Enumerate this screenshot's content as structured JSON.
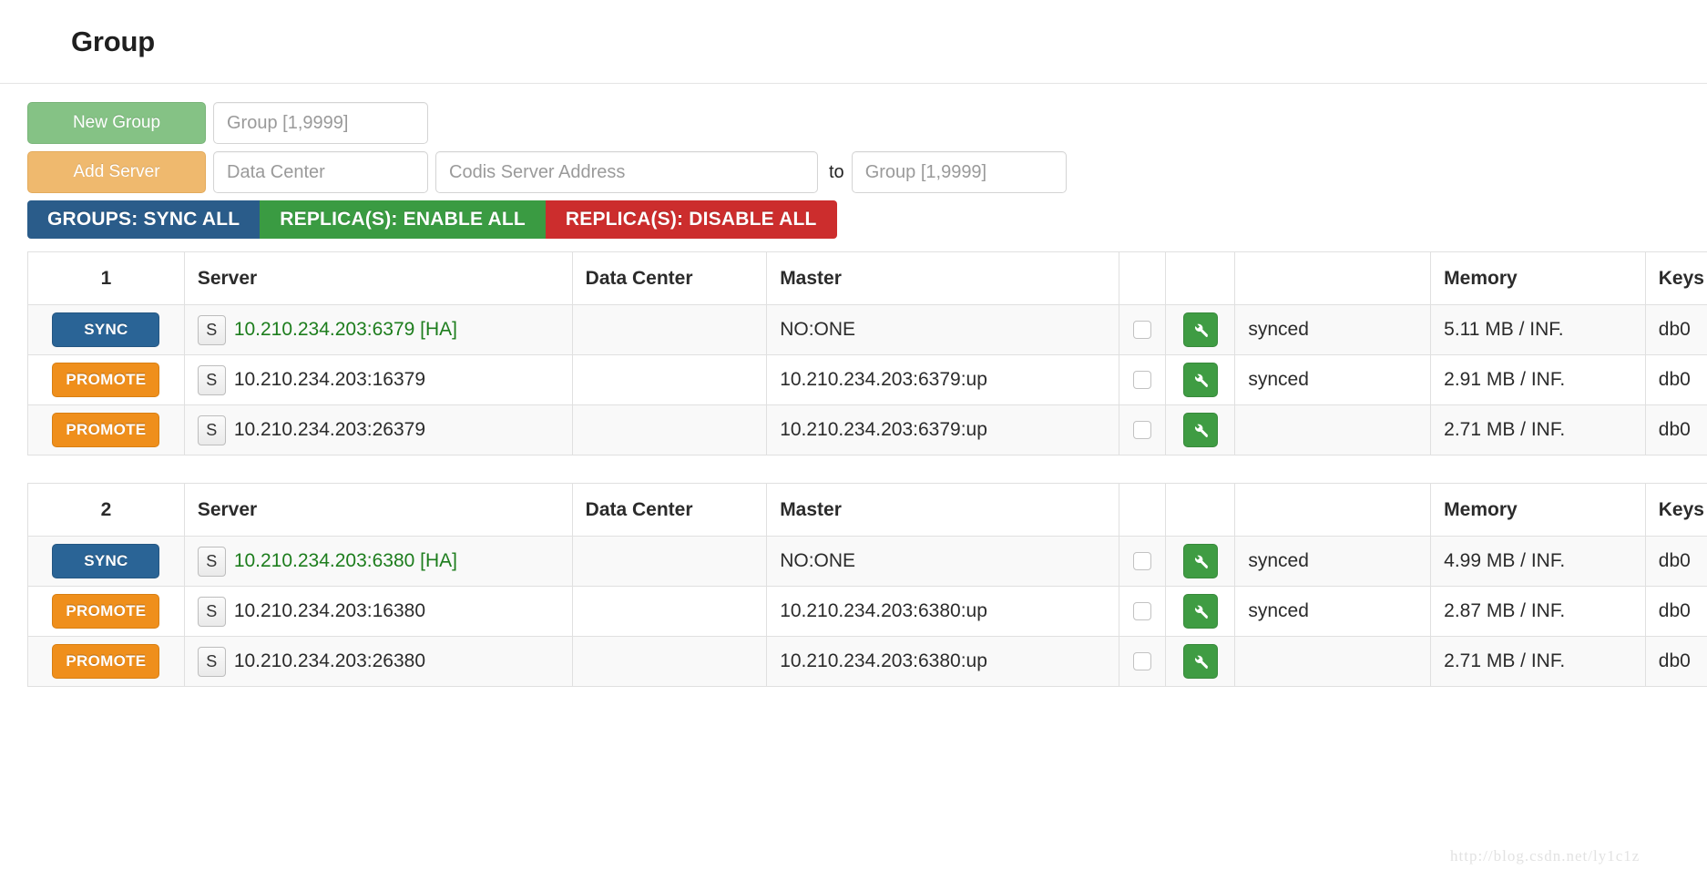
{
  "header": {
    "title": "Group"
  },
  "toolbar": {
    "new_group_label": "New Group",
    "add_server_label": "Add Server",
    "group_placeholder": "Group [1,9999]",
    "data_center_placeholder": "Data Center",
    "server_address_placeholder": "Codis Server Address",
    "to_label": "to",
    "target_group_placeholder": "Group [1,9999]",
    "group_value": "",
    "data_center_value": "",
    "server_address_value": "",
    "target_group_value": "",
    "bulk": {
      "sync_all": "GROUPS: SYNC ALL",
      "enable_all": "REPLICA(S): ENABLE ALL",
      "disable_all": "REPLICA(S): DISABLE ALL"
    },
    "colors": {
      "new_group": "#85c285",
      "add_server": "#efb96e",
      "sync_all": "#2a5c8a",
      "enable_all": "#3a9b42",
      "disable_all": "#cc2d2d"
    }
  },
  "columns": {
    "index": "1",
    "server": "Server",
    "data_center": "Data Center",
    "master": "Master",
    "blank_checkbox": "",
    "blank_tool": "",
    "status": "",
    "memory": "Memory",
    "keys": "Keys"
  },
  "groups": [
    {
      "id": "1",
      "headers": {
        "index": "1",
        "server": "Server",
        "data_center": "Data Center",
        "master": "Master",
        "memory": "Memory",
        "keys": "Keys"
      },
      "rows": [
        {
          "action": "SYNC",
          "action_kind": "sync",
          "badge": "S",
          "server": "10.210.234.203:6379 [HA]",
          "is_ha": true,
          "data_center": "",
          "master": "NO:ONE",
          "checked": false,
          "tool": "wrench-icon",
          "status": "synced",
          "memory": "5.11 MB / INF.",
          "keys": "db0",
          "alt": true
        },
        {
          "action": "PROMOTE",
          "action_kind": "promote",
          "badge": "S",
          "server": "10.210.234.203:16379",
          "is_ha": false,
          "data_center": "",
          "master": "10.210.234.203:6379:up",
          "checked": false,
          "tool": "wrench-icon",
          "status": "synced",
          "memory": "2.91 MB / INF.",
          "keys": "db0",
          "alt": false
        },
        {
          "action": "PROMOTE",
          "action_kind": "promote",
          "badge": "S",
          "server": "10.210.234.203:26379",
          "is_ha": false,
          "data_center": "",
          "master": "10.210.234.203:6379:up",
          "checked": false,
          "tool": "wrench-icon",
          "status": "",
          "memory": "2.71 MB / INF.",
          "keys": "db0",
          "alt": true
        }
      ]
    },
    {
      "id": "2",
      "headers": {
        "index": "2",
        "server": "Server",
        "data_center": "Data Center",
        "master": "Master",
        "memory": "Memory",
        "keys": "Keys"
      },
      "rows": [
        {
          "action": "SYNC",
          "action_kind": "sync",
          "badge": "S",
          "server": "10.210.234.203:6380 [HA]",
          "is_ha": true,
          "data_center": "",
          "master": "NO:ONE",
          "checked": false,
          "tool": "wrench-icon",
          "status": "synced",
          "memory": "4.99 MB / INF.",
          "keys": "db0",
          "alt": true
        },
        {
          "action": "PROMOTE",
          "action_kind": "promote",
          "badge": "S",
          "server": "10.210.234.203:16380",
          "is_ha": false,
          "data_center": "",
          "master": "10.210.234.203:6380:up",
          "checked": false,
          "tool": "wrench-icon",
          "status": "synced",
          "memory": "2.87 MB / INF.",
          "keys": "db0",
          "alt": false
        },
        {
          "action": "PROMOTE",
          "action_kind": "promote",
          "badge": "S",
          "server": "10.210.234.203:26380",
          "is_ha": false,
          "data_center": "",
          "master": "10.210.234.203:6380:up",
          "checked": false,
          "tool": "wrench-icon",
          "status": "",
          "memory": "2.71 MB / INF.",
          "keys": "db0",
          "alt": true
        }
      ]
    }
  ],
  "watermark": "http://blog.csdn.net/ly1c1z"
}
